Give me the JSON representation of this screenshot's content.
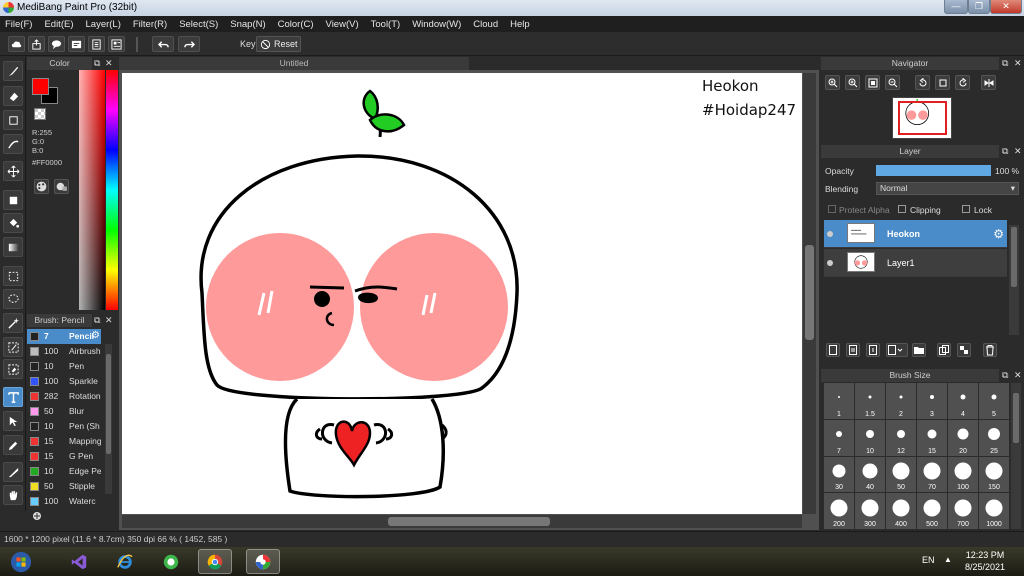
{
  "window": {
    "title": "MediBang Paint Pro (32bit)",
    "controls": [
      "—",
      "❐",
      "✕"
    ]
  },
  "menu": [
    "File(F)",
    "Edit(E)",
    "Layer(L)",
    "Filter(R)",
    "Select(S)",
    "Snap(N)",
    "Color(C)",
    "View(V)",
    "Tool(T)",
    "Window(W)",
    "Cloud",
    "Help"
  ],
  "toolbar": {
    "key_label": "Key",
    "reset_label": "Reset"
  },
  "color_panel": {
    "title": "Color",
    "r": "R:255",
    "g": "G:0",
    "b": "B:0",
    "hex": "#FF0000",
    "foreground": "#ff0000",
    "background": "#000000"
  },
  "brush_panel": {
    "title": "Brush: Pencil",
    "items": [
      {
        "size": "7",
        "name": "Pencil",
        "color": "#222222",
        "active": true
      },
      {
        "size": "100",
        "name": "Airbrush",
        "color": "#bbbbbb"
      },
      {
        "size": "10",
        "name": "Pen",
        "color": "#222222"
      },
      {
        "size": "100",
        "name": "Sparkle",
        "color": "#3355ff"
      },
      {
        "size": "282",
        "name": "Rotation",
        "color": "#ee3333"
      },
      {
        "size": "50",
        "name": "Blur",
        "color": "#ff99ee"
      },
      {
        "size": "10",
        "name": "Pen (Sh",
        "color": "#222222"
      },
      {
        "size": "15",
        "name": "Mapping",
        "color": "#ee3333"
      },
      {
        "size": "15",
        "name": "G Pen",
        "color": "#ee3333"
      },
      {
        "size": "10",
        "name": "Edge Pe",
        "color": "#22aa22"
      },
      {
        "size": "50",
        "name": "Stipple",
        "color": "#eedd22"
      },
      {
        "size": "100",
        "name": "Waterc",
        "color": "#66ccff"
      }
    ]
  },
  "canvas": {
    "tab_title": "Untitled",
    "text_line1": "Heokon",
    "text_line2": "#Hoidap247"
  },
  "navigator": {
    "title": "Navigator"
  },
  "layer_panel": {
    "title": "Layer",
    "opacity_label": "Opacity",
    "opacity_value": "100 %",
    "opacity_fraction": 1.0,
    "blending_label": "Blending",
    "blending_value": "Normal",
    "protect_alpha": "Protect Alpha",
    "clipping": "Clipping",
    "lock": "Lock",
    "layers": [
      {
        "name": "Heokon",
        "active": true
      },
      {
        "name": "Layer1",
        "active": false
      }
    ]
  },
  "brush_size_panel": {
    "title": "Brush Size",
    "sizes": [
      "1",
      "1.5",
      "2",
      "3",
      "4",
      "5",
      "7",
      "10",
      "12",
      "15",
      "20",
      "25",
      "30",
      "40",
      "50",
      "70",
      "100",
      "150",
      "200",
      "300",
      "400",
      "500",
      "700",
      "1000"
    ]
  },
  "status": {
    "text": "1600 * 1200 pixel  (11.6 * 8.7cm)  350 dpi  66 %  ( 1452, 585 )"
  },
  "taskbar": {
    "lang": "EN",
    "time": "12:23 PM",
    "date": "8/25/2021"
  },
  "colors": {
    "accent": "#4a8cc9",
    "cheek": "#ff9a9a",
    "leaf": "#22cc22",
    "heart": "#ee2222"
  }
}
